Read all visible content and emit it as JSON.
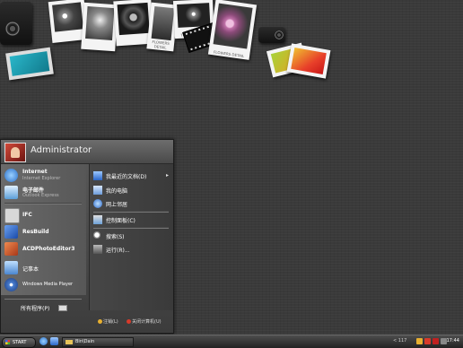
{
  "start_menu": {
    "user_name": "Administrator",
    "pinned": [
      {
        "title": "Internet",
        "subtitle": "Internet Explorer",
        "icon": "ie-icon",
        "color": "#3a8ee6"
      },
      {
        "title": "电子邮件",
        "subtitle": "Outlook Express",
        "icon": "mail-icon",
        "color": "#5b9fd8"
      }
    ],
    "recent": [
      {
        "title": "IFC",
        "icon": "ifc-icon",
        "color": "#d8d8d8"
      },
      {
        "title": "ResBuild",
        "icon": "resbuild-icon",
        "color": "#2a66c8"
      },
      {
        "title": "ACDPhotoEditor3",
        "icon": "acd-icon",
        "color": "#c8553a"
      },
      {
        "title": "记事本",
        "icon": "notepad-icon",
        "color": "#6aa6e8"
      },
      {
        "title": "Windows Media Player",
        "icon": "media-player-icon",
        "color": "#4a7fd0"
      }
    ],
    "all_programs": "所有程序(P)",
    "right": [
      {
        "label": "我最近的文档(D)",
        "icon": "recent-docs-icon",
        "color": "#3d7fd6",
        "submenu": true,
        "arrow": "▸"
      },
      {
        "label": "我的电脑",
        "icon": "my-computer-icon",
        "color": "#8ab4e6"
      },
      {
        "label": "网上邻居",
        "icon": "network-icon",
        "color": "#5a9ae0"
      },
      {
        "label": "控制面板(C)",
        "icon": "control-panel-icon",
        "color": "#6ca0d8"
      },
      {
        "label": "搜索(S)",
        "icon": "search-icon",
        "color": "#cccccc"
      },
      {
        "label": "运行(R)...",
        "icon": "run-icon",
        "color": "#9a9a9a"
      }
    ],
    "logoff_label": "注销(L)",
    "shutdown_label": "关闭计算机(U)"
  },
  "taskbar": {
    "start_label": "START",
    "task_label": "Bin\\Dain",
    "tray_text": "< 117",
    "clock": "17:44"
  },
  "wallpaper": {
    "captions": [
      "TO MY FRIENDS",
      "FLOWERS DETAIL",
      "FLOWERS DETAIL"
    ]
  }
}
